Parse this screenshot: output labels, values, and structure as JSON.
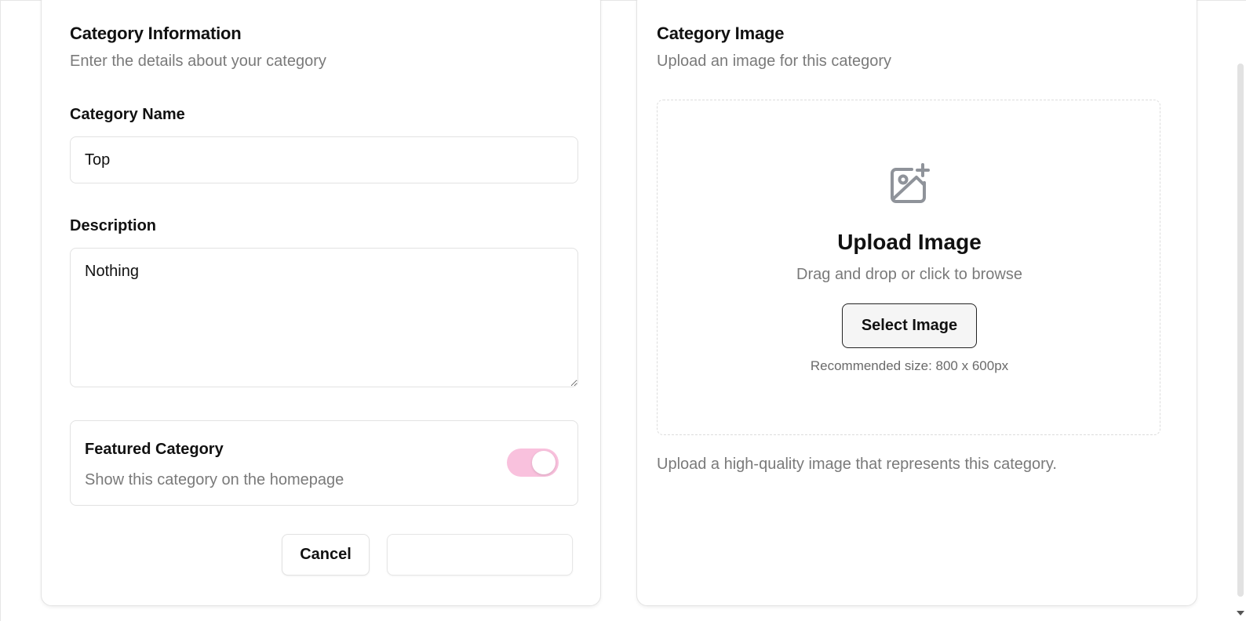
{
  "info_card": {
    "title": "Category Information",
    "subtitle": "Enter the details about your category",
    "name_label": "Category Name",
    "name_value": "Top",
    "description_label": "Description",
    "description_value": "Nothing",
    "featured": {
      "title": "Featured Category",
      "subtitle": "Show this category on the homepage",
      "enabled": true,
      "toggle_color": "#f9c1dd"
    },
    "cancel_label": "Cancel",
    "submit_label": ""
  },
  "image_card": {
    "title": "Category Image",
    "subtitle": "Upload an image for this category",
    "upload_icon": "image-plus-icon",
    "upload_title": "Upload Image",
    "upload_subtitle": "Drag and drop or click to browse",
    "select_label": "Select Image",
    "recommended": "Recommended size: 800 x 600px",
    "note": "Upload a high-quality image that represents this category."
  }
}
